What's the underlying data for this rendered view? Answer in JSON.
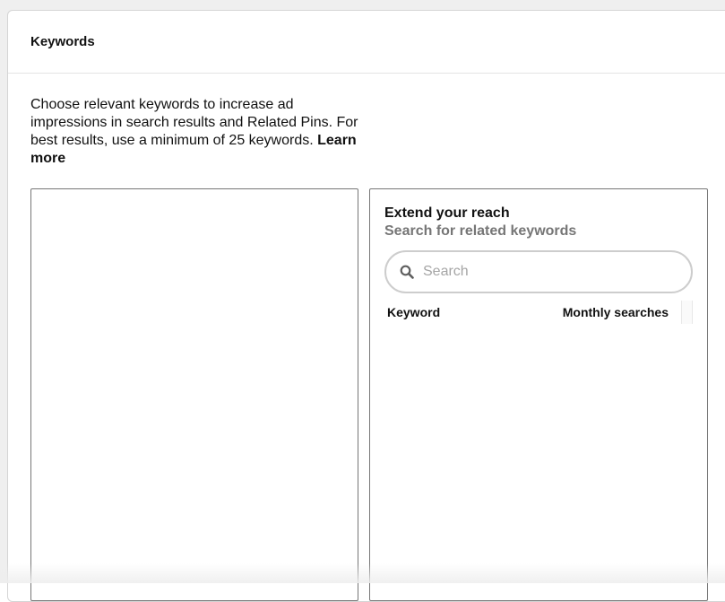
{
  "card": {
    "title": "Keywords"
  },
  "description": {
    "text": "Choose relevant keywords to increase ad impressions in search results and Related Pins. For best results, use a minimum of 25 keywords. ",
    "learn_more": "Learn more"
  },
  "reach_panel": {
    "title": "Extend your reach",
    "subtitle": "Search for related keywords",
    "search": {
      "placeholder": "Search",
      "value": "",
      "icon": "search-icon"
    },
    "table": {
      "columns": [
        "Keyword",
        "Monthly searches"
      ],
      "rows": []
    }
  },
  "keyword_list": {
    "items": []
  }
}
